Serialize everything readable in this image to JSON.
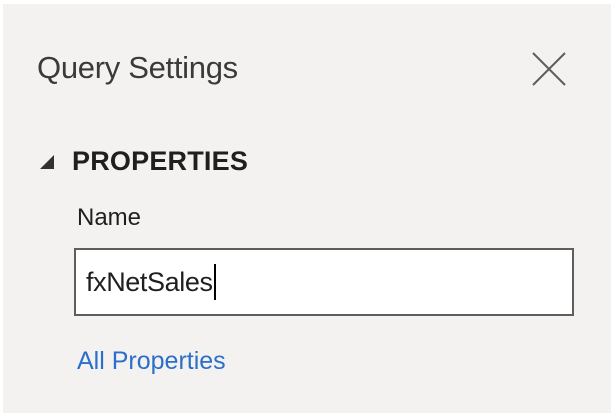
{
  "panel": {
    "title": "Query Settings",
    "close_icon": "close-icon",
    "section": {
      "title": "PROPERTIES",
      "expanded": true,
      "toggle_icon": "expanded-triangle-icon"
    },
    "name_label": "Name",
    "name_value": "fxNetSales",
    "all_properties_link": "All Properties"
  },
  "colors": {
    "panel_background": "#f3f2f1",
    "link": "#2b6fc9",
    "input_border": "#605e5c"
  }
}
